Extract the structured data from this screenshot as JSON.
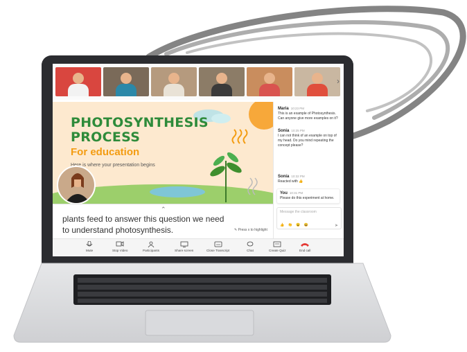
{
  "thumbnails": [
    {
      "name": "participant-1",
      "bg": "#d9463f",
      "shirt": "#f2f2f2"
    },
    {
      "name": "participant-2",
      "bg": "#7a6a59",
      "shirt": "#2b88a8"
    },
    {
      "name": "participant-3",
      "bg": "#b59a7e",
      "shirt": "#e9e2d6"
    },
    {
      "name": "participant-4",
      "bg": "#8c7c67",
      "shirt": "#3a3a3a"
    },
    {
      "name": "participant-5",
      "bg": "#c98d5e",
      "shirt": "#d9534f"
    },
    {
      "name": "participant-6",
      "bg": "#c9b7a1",
      "shirt": "#e04e3c"
    }
  ],
  "slide": {
    "title_line1": "PHOTOSYNTHESIS",
    "title_line2": "PROCESS",
    "subtitle": "For education",
    "caption": "Here is where your presentation begins"
  },
  "transcript": {
    "text": "plants feed to answer this question we need to understand photosynthesis.",
    "hint": "Press x to highlight"
  },
  "chat": {
    "messages": [
      {
        "name": "Maria",
        "time": "10:23 PM",
        "text": "This is an example of Photosynthesis. Can anyone give more examples on it?"
      },
      {
        "name": "Sonia",
        "time": "10:25 PM",
        "text": "I can not think of an example on top of my head. Do you mind repeating the concept please?"
      },
      {
        "name": "You",
        "time": "10:31 PM",
        "text": "Please do this experiment at home."
      },
      {
        "name": "Sonia",
        "time": "10:32 PM",
        "text": "Reacted with 👍"
      }
    ],
    "input_placeholder": "Message the classroom",
    "emojis": "👍 👏 😮 😆",
    "send_icon": "send-icon"
  },
  "toolbar": {
    "mute": "Mute",
    "stop_video": "Stop Video",
    "participants": "Participants",
    "share_screen": "Share screen",
    "close_transcript": "Close Transcript",
    "chat": "Chat",
    "create_quiz": "Create Quiz",
    "end_call": "End call"
  },
  "colors": {
    "title_green": "#2e8b3a",
    "subtitle_orange": "#f39c12",
    "slide_bg": "#fde9cf",
    "end_call_red": "#e53935"
  }
}
